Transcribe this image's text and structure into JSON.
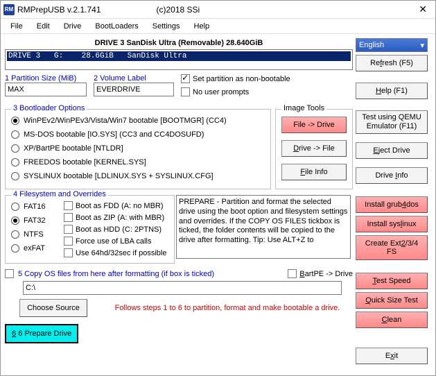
{
  "titlebar": {
    "app": "RMPrepUSB v.2.1.741",
    "copyright": "(c)2018 SSi",
    "close": "✕"
  },
  "menu": {
    "file": "File",
    "edit": "Edit",
    "drive": "Drive",
    "bootloaders": "BootLoaders",
    "settings": "Settings",
    "help": "Help"
  },
  "drive_title": "DRIVE 3 SanDisk Ultra  (Removable) 28.640GiB",
  "drive_row": "DRIVE 3   G:    28.6GiB   SanDisk Ultra",
  "partition": {
    "label": "1 Partition Size (MiB)",
    "value": "MAX"
  },
  "volume": {
    "label": "2 Volume Label",
    "value": "EVERDRIVE"
  },
  "opts": {
    "nonboot": "Set partition as non-bootable",
    "nouser": "No user prompts"
  },
  "bootloader": {
    "legend": "3 Bootloader Options",
    "o1": "WinPEv2/WinPEv3/Vista/Win7 bootable [BOOTMGR] (CC4)",
    "o2": "MS-DOS bootable [IO.SYS]     (CC3 and CC4DOSUFD)",
    "o3": "XP/BartPE bootable [NTLDR]",
    "o4": "FREEDOS bootable [KERNEL.SYS]",
    "o5": "SYSLINUX bootable [LDLINUX.SYS + SYSLINUX.CFG]"
  },
  "imagetools": {
    "legend": "Image Tools",
    "file2drive": "File -> Drive",
    "drive2file": "Drive -> File",
    "fileinfo": "File Info"
  },
  "fs": {
    "legend": "4 Filesystem and Overrides",
    "fat16": "FAT16",
    "fat32": "FAT32",
    "ntfs": "NTFS",
    "exfat": "exFAT",
    "fdd": "Boot as FDD (A: no MBR)",
    "zip": "Boot as ZIP (A: with MBR)",
    "hdd": "Boot as HDD (C: 2PTNS)",
    "lba": "Force use of LBA calls",
    "s64": "Use 64hd/32sec if possible"
  },
  "preparetext": "PREPARE - Partition and format the selected drive using the boot option and filesystem settings and overrides. If the COPY OS FILES tickbox is ticked, the folder contents will be copied to the drive after formatting. Tip: Use ALT+Z to",
  "copyos": {
    "label": "5 Copy OS files from here after formatting (if box is ticked)",
    "bartpe": "BartPE -> Drive",
    "path": "C:\\",
    "choose": "Choose Source"
  },
  "instructions": "Follows steps 1 to 6 to partition, format and make bootable a drive.",
  "prepare": "6 Prepare Drive",
  "right": {
    "lang": "English",
    "refresh": "Refresh (F5)",
    "help": "Help  (F1)",
    "qemu": "Test using QEMU Emulator (F11)",
    "eject": "Eject Drive",
    "driveinfo": "Drive Info",
    "grub": "Install grub4dos",
    "syslinux": "Install syslinux",
    "ext": "Create Ext2/3/4 FS",
    "testspeed": "Test Speed",
    "quicksize": "Quick Size Test",
    "clean": "Clean",
    "exit": "Exit"
  }
}
